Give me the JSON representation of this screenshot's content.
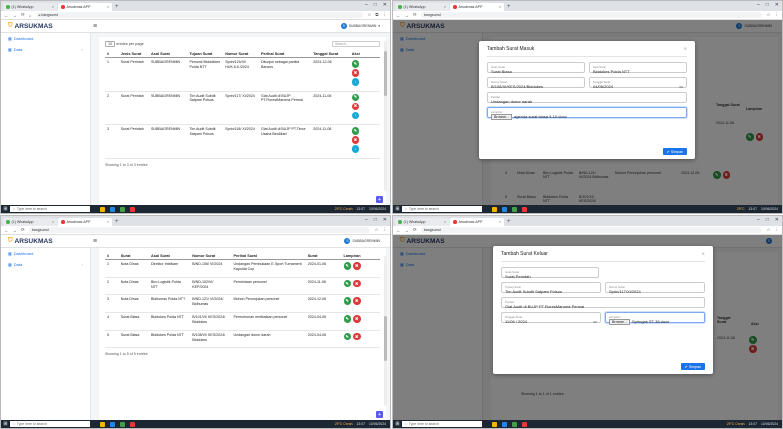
{
  "browser": {
    "tab1": "(1) WhatsApp",
    "tab2": "Arsukmas APP",
    "tab_close": "×",
    "new_tab": "+",
    "url_blurred": "arsukmas.bagsumdatkita.id/surat_masuk",
    "url_domain": "bangsumd"
  },
  "app": {
    "name": "ARSUKMAS",
    "user": "SUBBAGRENMIN",
    "menu_dashboard": "Dashboard",
    "menu_data": "Data"
  },
  "q1": {
    "show_prefix": "Show",
    "show_count": "10",
    "show_suffix": "entries per page",
    "search_placeholder": "Search...",
    "headers": [
      "#",
      "Jenis Surat",
      "Asal Surat",
      "Tujuan Surat",
      "Nomor Surat",
      "Perihal Surat",
      "Tanggal Surat",
      "Aksi"
    ],
    "rows": [
      {
        "no": "1",
        "jenis": "Surat Perintah",
        "asal": "SUBBAGRENMIN",
        "tujuan": "Personil Biddokkes Polda NTT",
        "nomor": "Sprin/124/XI/ HUK.6.6./2024",
        "perihal": "Ditunjuk sebagai panitia Bansos",
        "tanggal": "2024-12-06"
      },
      {
        "no": "2",
        "jenis": "Surat Perintah",
        "asal": "SUBBAGRENMIN",
        "tujuan": "Tim Audit Subdit Satpam Polsus",
        "nomor": "Sprin/117/ XI/2024",
        "perihal": "Giat Audit di BUJP PT.FlorestMaroma Permai",
        "tanggal": "2024-11-06"
      },
      {
        "no": "3",
        "jenis": "Surat Perintah",
        "asal": "SUBBAGRENMIN",
        "tujuan": "Tim Audit Subdit Satpam Polsus",
        "nomor": "Sprin/118/ XI/2024",
        "perihal": "Giat Audit di BUJP PT.Timor Usaha Berdikari",
        "tanggal": "2024-11-06"
      }
    ],
    "footer": "Showing 1 to 3 of 3 entries"
  },
  "q2": {
    "modal_title": "Tambah Surat Masuk",
    "f_jenis_label": "Jenis Surat",
    "f_jenis": "Surat Biasa",
    "f_asal_label": "Asal Surat",
    "f_asal": "Biddokes Polda NTT",
    "f_nomor_label": "Nomor Surat",
    "f_nomor": "B/108/XI/KES/2024/Biddokes",
    "f_tanggal_label": "Tanggal Surat",
    "f_tanggal": "04/06/2024",
    "f_perihal_label": "Perihal",
    "f_perihal": "Undangan donor darah",
    "f_lampiran_label": "Lampiran",
    "browse": "Browse...",
    "f_lampiran": "agenda surat biasa 9-10.docx",
    "save": "Simpan",
    "bg_head1": "Tanggal Surat",
    "bg_head2": "Lampiran",
    "bg_date1": "2024-11-06",
    "bg_r1": [
      "4",
      "Nota Dinas",
      "Biro Logistik Polda NTT",
      "B/ND-121/ XI/2024 Bidhumas",
      "Mohon Penunjukan personel",
      "2024-12-06"
    ],
    "bg_r2": [
      "5",
      "Surat Biasa",
      "Biddokes Polda NTT",
      "B/101/XI/ KES/2024/"
    ]
  },
  "q3": {
    "headers": [
      "#",
      "Surat",
      "Asal Surat",
      "Nomor Surat",
      "Perihal Surat",
      "Surat",
      "Lampiran"
    ],
    "rows": [
      {
        "no": "1",
        "jenis": "Nota Dinas",
        "asal": "Direktur Intelkam",
        "nomor": "B/ND-106/ VI/2024",
        "perihal": "Undangan Pembukaan E-Sport Turnament Kapolda Cup",
        "tanggal": "2024-01-06"
      },
      {
        "no": "2",
        "jenis": "Nota Dinas",
        "asal": "Biro Logistik Polda NTT",
        "nomor": "B/ND-102/VI/ KEP/2024",
        "perihal": "Permintaan personel",
        "tanggal": "2024-11-06"
      },
      {
        "no": "3",
        "jenis": "Nota Dinas",
        "asal": "Bidhumas Polda NTT",
        "nomor": "B/ND-121/ VI/2024/ Bidhumas",
        "perihal": "Mohon Penunjukan personel",
        "tanggal": "2024-12-06"
      },
      {
        "no": "4",
        "jenis": "Surat Biasa",
        "asal": "Biddokes Polda NTT",
        "nomor": "B/101/VI/ KES/2024/ Biddokes",
        "perihal": "Permohonan melibatkan personel",
        "tanggal": "2024-04-06"
      },
      {
        "no": "5",
        "jenis": "Surat Biasa",
        "asal": "Biddokes Polda NTT",
        "nomor": "B/108/VI/ KES/2024/ Biddokes",
        "perihal": "Undangan donor darah",
        "tanggal": "2024-04-06"
      }
    ],
    "footer": "Showing 1 to 5 of 5 entries"
  },
  "q4": {
    "modal_title": "Tambah Surat Keluar",
    "f_jenis_label": "Jenis Surat",
    "f_jenis": "Surat Perintah",
    "f_tujuan_label": "Tujuan Surat",
    "f_tujuan": "Tim Audit Subdit Satpam Polsus",
    "f_nomor_label": "Nomor Surat",
    "f_nomor": "Sprin/117/XI/2024",
    "f_perihal_label": "Perihal",
    "f_perihal": "Giat Audit di BUJP PT.FloresMaroma Permai",
    "f_tanggal_label": "Tanggal Surat",
    "f_tanggal": "11/06 / 2024",
    "f_lampiran_label": "Lampiran",
    "browse": "Browse...",
    "f_lampiran": "Springas ST-38.docx",
    "save": "Simpan",
    "bg_head1": "Tanggal Surat",
    "bg_head2": "Aksi",
    "bg_date": "2024-11-06",
    "bg_footer": "Showing 1 to 1 of 1 entries"
  },
  "taskbar": {
    "search": "Type here to search",
    "weather1": "29°C Cerah",
    "weather2": "29°C",
    "time1": "13:07",
    "date1": "10/06/2024",
    "time2": "13:07",
    "date2": "10/06/2024"
  }
}
